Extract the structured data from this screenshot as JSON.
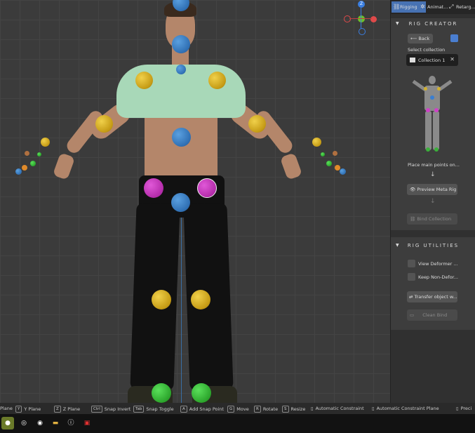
{
  "panel": {
    "tabs": [
      {
        "label": "Rigging",
        "icon": "rigging-icon"
      },
      {
        "label": "Animat...",
        "icon": "animation-icon"
      },
      {
        "label": "Retarg...",
        "icon": "retarget-icon"
      }
    ],
    "rig_creator": {
      "title": "RIG CREATOR",
      "back_label": "Back",
      "select_collection_label": "Select collection",
      "collection_name": "Collection 1",
      "place_points_label": "Place main points on...",
      "preview_label": "Preview Meta Rig",
      "bind_label": "Bind Collection"
    },
    "rig_utilities": {
      "title": "RIG UTILITIES",
      "view_deformer_label": "View Deformer ...",
      "keep_non_deformer_label": "Keep Non-Defor...",
      "transfer_label": "Transfer object w...",
      "clean_bind_label": "Clean Bind"
    }
  },
  "statusbar": {
    "items": [
      {
        "key": "X",
        "label": "Plane"
      },
      {
        "key": "Y",
        "label": "Y Plane"
      },
      {
        "key": "Z",
        "label": "Z Plane"
      },
      {
        "key": "Ctrl",
        "label": "Snap Invert"
      },
      {
        "key": "Tab",
        "label": "Snap Toggle"
      },
      {
        "key": "A",
        "label": "Add Snap Point"
      },
      {
        "key": "G",
        "label": "Move"
      },
      {
        "key": "R",
        "label": "Rotate"
      },
      {
        "key": "S",
        "label": "Resize"
      },
      {
        "key": "",
        "label": "Automatic Constraint"
      },
      {
        "key": "",
        "label": "Automatic Constraint Plane"
      },
      {
        "key": "",
        "label": "Preci"
      }
    ]
  },
  "gizmo": {
    "z_label": "Z",
    "x_color": "#e04a4a",
    "y_color": "#6cc02c",
    "z_color": "#3a7ee0"
  },
  "taskbar": {
    "apps": [
      "blender-icon",
      "obs-icon",
      "chrome-icon",
      "files-icon",
      "info-icon",
      "adobe-icon"
    ]
  }
}
